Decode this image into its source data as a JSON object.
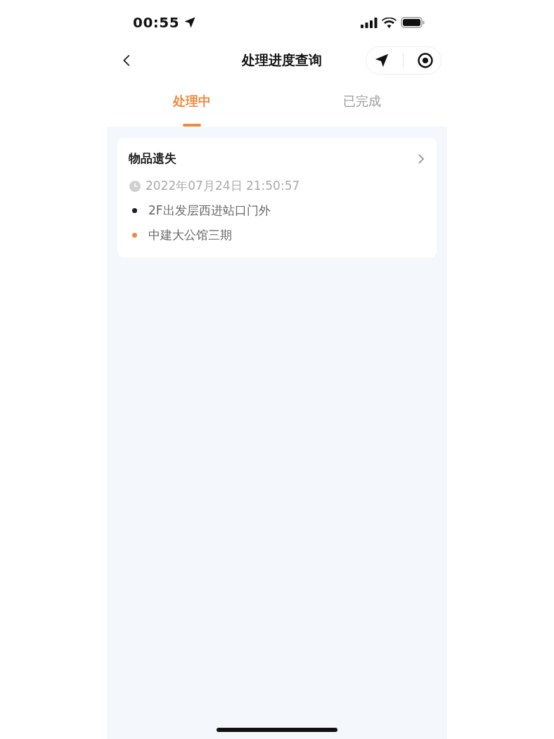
{
  "status_bar": {
    "time": "00:55"
  },
  "nav": {
    "title": "处理进度查询"
  },
  "tabs": [
    {
      "label": "处理中",
      "selected": true
    },
    {
      "label": "已完成",
      "selected": false
    }
  ],
  "cards": [
    {
      "title": "物品遗失",
      "time": "2022年07月24日 21:50:57",
      "locations": [
        {
          "text": "2F出发层西进站口门外",
          "color": "#1e1f2e"
        },
        {
          "text": "中建大公馆三期",
          "color": "#f08a4b"
        }
      ]
    }
  ]
}
